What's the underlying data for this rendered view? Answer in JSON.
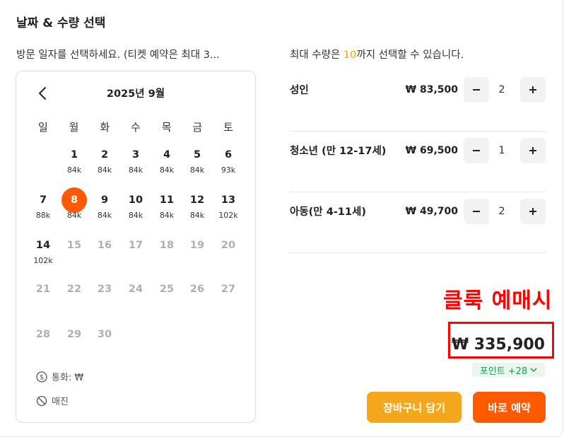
{
  "title": "날짜 & 수량 선택",
  "calendar": {
    "subtitle": "방문 일자를 선택하세요. (티켓 예약은 최대 3...",
    "month_label": "2025년 9월",
    "weekdays": [
      "일",
      "월",
      "화",
      "수",
      "목",
      "금",
      "토"
    ],
    "days": [
      {
        "day": "1",
        "price": "84k",
        "available": true
      },
      {
        "day": "2",
        "price": "84k",
        "available": true
      },
      {
        "day": "3",
        "price": "84k",
        "available": true
      },
      {
        "day": "4",
        "price": "84k",
        "available": true
      },
      {
        "day": "5",
        "price": "84k",
        "available": true
      },
      {
        "day": "6",
        "price": "93k",
        "available": true
      },
      {
        "day": "7",
        "price": "88k",
        "available": true
      },
      {
        "day": "8",
        "price": "84k",
        "available": true,
        "selected": true
      },
      {
        "day": "9",
        "price": "84k",
        "available": true
      },
      {
        "day": "10",
        "price": "84k",
        "available": true
      },
      {
        "day": "11",
        "price": "84k",
        "available": true
      },
      {
        "day": "12",
        "price": "84k",
        "available": true
      },
      {
        "day": "13",
        "price": "102k",
        "available": true
      },
      {
        "day": "14",
        "price": "102k",
        "available": true
      },
      {
        "day": "15",
        "price": "",
        "available": false
      },
      {
        "day": "16",
        "price": "",
        "available": false
      },
      {
        "day": "17",
        "price": "",
        "available": false
      },
      {
        "day": "18",
        "price": "",
        "available": false
      },
      {
        "day": "19",
        "price": "",
        "available": false
      },
      {
        "day": "20",
        "price": "",
        "available": false
      },
      {
        "day": "21",
        "price": "",
        "available": false
      },
      {
        "day": "22",
        "price": "",
        "available": false
      },
      {
        "day": "23",
        "price": "",
        "available": false
      },
      {
        "day": "24",
        "price": "",
        "available": false
      },
      {
        "day": "25",
        "price": "",
        "available": false
      },
      {
        "day": "26",
        "price": "",
        "available": false
      },
      {
        "day": "27",
        "price": "",
        "available": false
      },
      {
        "day": "28",
        "price": "",
        "available": false
      },
      {
        "day": "29",
        "price": "",
        "available": false
      },
      {
        "day": "30",
        "price": "",
        "available": false
      }
    ],
    "legend_currency": "통화: ₩",
    "legend_soldout": "매진"
  },
  "quantity": {
    "note_prefix": "최대 수량은 ",
    "note_max": "10",
    "note_suffix": "까지 선택할 수 있습니다.",
    "rows": [
      {
        "label": "성인",
        "price": "₩ 83,500",
        "count": "2"
      },
      {
        "label": "청소년 (만 12-17세)",
        "price": "₩ 69,500",
        "count": "1"
      },
      {
        "label": "아동(만 4-11세)",
        "price": "₩ 49,700",
        "count": "2"
      }
    ]
  },
  "annotation": "클룩 예매시",
  "total": "₩ 335,900",
  "points_label": "포인트 +28",
  "buttons": {
    "cart": "장바구니 담기",
    "book": "바로 예약"
  },
  "colors": {
    "accent": "#ff5a00",
    "cart": "#f4a61c",
    "annotation": "#ff0000",
    "points": "#1a9a4a"
  }
}
